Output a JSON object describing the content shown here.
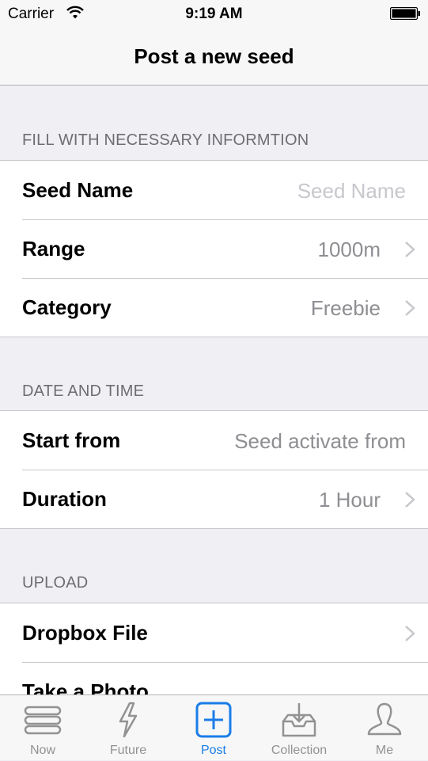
{
  "status_bar": {
    "carrier": "Carrier",
    "time": "9:19 AM"
  },
  "nav": {
    "title": "Post a new seed"
  },
  "sections": {
    "info": {
      "header": "FILL WITH NECESSARY INFORMTION",
      "seed_name_label": "Seed Name",
      "seed_name_placeholder": "Seed Name",
      "range_label": "Range",
      "range_value": "1000m",
      "category_label": "Category",
      "category_value": "Freebie"
    },
    "datetime": {
      "header": "DATE AND TIME",
      "start_label": "Start from",
      "start_placeholder": "Seed activate from",
      "duration_label": "Duration",
      "duration_value": "1 Hour"
    },
    "upload": {
      "header": "UPLOAD",
      "dropbox_label": "Dropbox File",
      "photo_label": "Take a Photo"
    }
  },
  "tabs": [
    {
      "label": "Now",
      "icon": "stack-icon",
      "active": false
    },
    {
      "label": "Future",
      "icon": "lightning-icon",
      "active": false
    },
    {
      "label": "Post",
      "icon": "plus-square-icon",
      "active": true
    },
    {
      "label": "Collection",
      "icon": "inbox-download-icon",
      "active": false
    },
    {
      "label": "Me",
      "icon": "person-icon",
      "active": false
    }
  ],
  "colors": {
    "accent": "#1a7de8",
    "inactive_tab": "#929292",
    "background": "#efeff4"
  }
}
